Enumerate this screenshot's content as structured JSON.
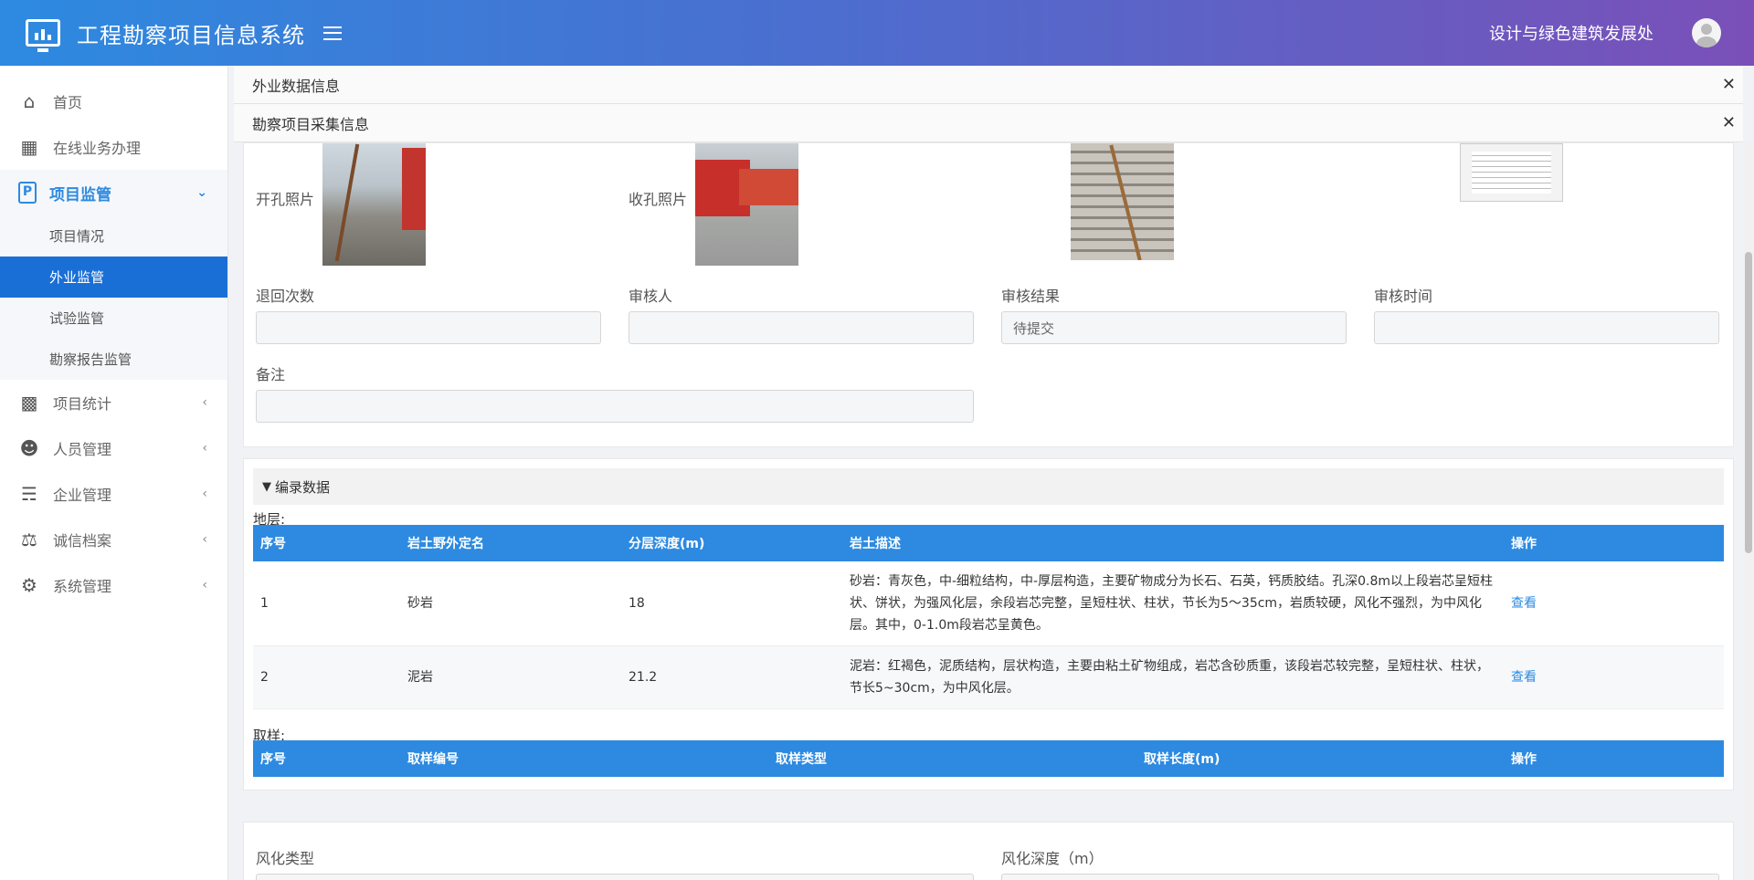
{
  "header": {
    "title": "工程勘察项目信息系统",
    "department": "设计与绿色建筑发展处"
  },
  "sidebar": {
    "items": [
      {
        "label": "首页",
        "icon": "home-icon"
      },
      {
        "label": "在线业务办理",
        "icon": "contact-card-icon"
      },
      {
        "label": "项目监管",
        "icon": "project-p-icon",
        "expanded": true,
        "children": [
          {
            "label": "项目情况"
          },
          {
            "label": "外业监管",
            "active": true
          },
          {
            "label": "试验监管"
          },
          {
            "label": "勘察报告监管"
          }
        ]
      },
      {
        "label": "项目统计",
        "icon": "cubes-icon"
      },
      {
        "label": "人员管理",
        "icon": "user-circle-icon"
      },
      {
        "label": "企业管理",
        "icon": "org-chart-icon"
      },
      {
        "label": "诚信档案",
        "icon": "scale-icon"
      },
      {
        "label": "系统管理",
        "icon": "gear-icon"
      }
    ]
  },
  "tabs": [
    {
      "label": "外业数据信息"
    },
    {
      "label": "勘察项目采集信息"
    }
  ],
  "photos": {
    "open_hole": "开孔照片",
    "close_hole": "收孔照片"
  },
  "review": {
    "return_count_label": "退回次数",
    "return_count_value": "",
    "reviewer_label": "审核人",
    "reviewer_value": "",
    "result_label": "审核结果",
    "result_value": "待提交",
    "time_label": "审核时间",
    "time_value": "",
    "remark_label": "备注",
    "remark_value": ""
  },
  "records": {
    "section_title": "编录数据",
    "strata_label": "地层:",
    "strata_headers": [
      "序号",
      "岩土野外定名",
      "分层深度(m)",
      "岩土描述",
      "操作"
    ],
    "strata_rows": [
      {
        "no": "1",
        "name": "砂岩",
        "depth": "18",
        "desc": "砂岩：青灰色，中-细粒结构，中-厚层构造，主要矿物成分为长石、石英，钙质胶结。孔深0.8m以上段岩芯呈短柱状、饼状，为强风化层，余段岩芯完整，呈短柱状、柱状，节长为5～35cm，岩质较硬，风化不强烈，为中风化层。其中，0-1.0m段岩芯呈黄色。",
        "action": "查看"
      },
      {
        "no": "2",
        "name": "泥岩",
        "depth": "21.2",
        "desc": "泥岩：红褐色，泥质结构，层状构造，主要由粘土矿物组成，岩芯含砂质重，该段岩芯较完整，呈短柱状、柱状，节长5~30cm，为中风化层。",
        "action": "查看"
      }
    ],
    "sample_label": "取样:",
    "sample_headers": [
      "序号",
      "取样编号",
      "取样类型",
      "取样长度(m)",
      "操作"
    ]
  },
  "weathering": {
    "type_label": "风化类型",
    "depth_label": "风化深度（m）"
  }
}
